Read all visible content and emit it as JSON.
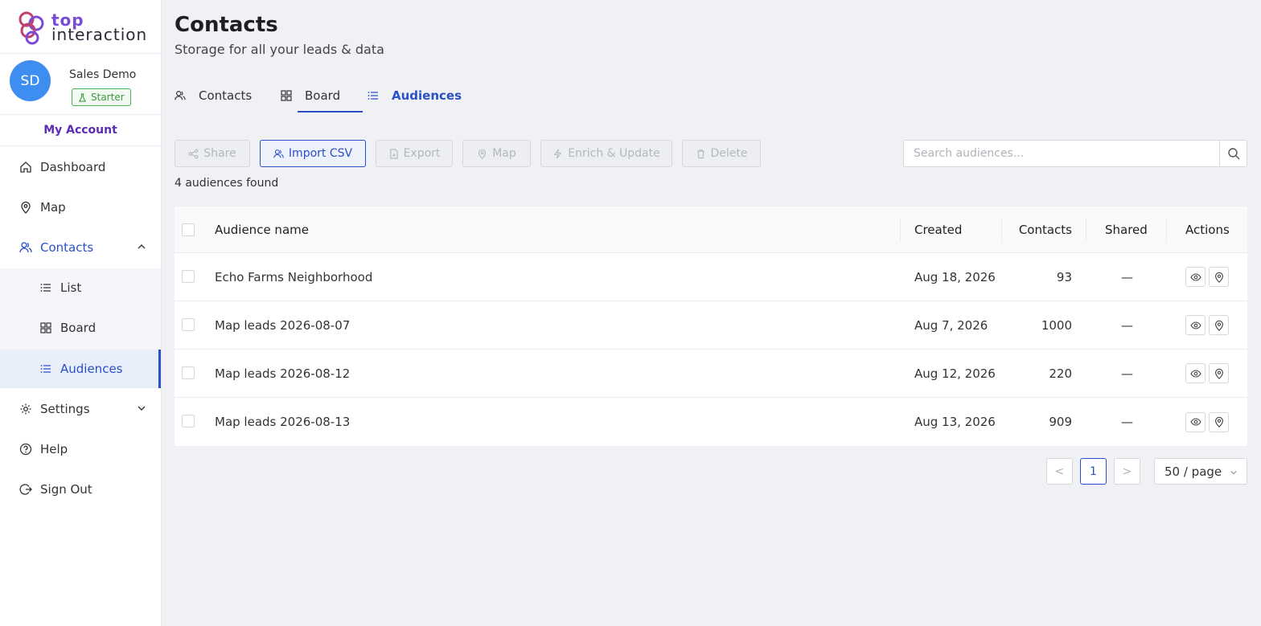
{
  "brand": {
    "line1": "top",
    "line2": "interaction"
  },
  "profile": {
    "initials": "SD",
    "name": "Sales Demo",
    "plan": "Starter"
  },
  "my_account_label": "My Account",
  "nav": {
    "dashboard": "Dashboard",
    "map": "Map",
    "contacts": "Contacts",
    "list": "List",
    "board": "Board",
    "audiences": "Audiences",
    "settings": "Settings",
    "help": "Help",
    "sign_out": "Sign Out"
  },
  "page": {
    "title": "Contacts",
    "subtitle": "Storage for all your leads & data"
  },
  "tabs": {
    "contacts": "Contacts",
    "board": "Board",
    "audiences": "Audiences"
  },
  "toolbar": {
    "share": "Share",
    "import_csv": "Import CSV",
    "export": "Export",
    "map": "Map",
    "enrich": "Enrich & Update",
    "delete": "Delete"
  },
  "search": {
    "placeholder": "Search audiences..."
  },
  "found_count": "4 audiences found",
  "table": {
    "columns": {
      "name": "Audience name",
      "created": "Created",
      "contacts": "Contacts",
      "shared": "Shared",
      "actions": "Actions"
    },
    "rows": [
      {
        "name": "Echo Farms Neighborhood",
        "created": "Aug 18, 2026",
        "contacts": "93",
        "shared": "—"
      },
      {
        "name": "Map leads 2026-08-07",
        "created": "Aug 7, 2026",
        "contacts": "1000",
        "shared": "—"
      },
      {
        "name": "Map leads 2026-08-12",
        "created": "Aug 12, 2026",
        "contacts": "220",
        "shared": "—"
      },
      {
        "name": "Map leads 2026-08-13",
        "created": "Aug 13, 2026",
        "contacts": "909",
        "shared": "—"
      }
    ]
  },
  "pagination": {
    "prev": "<",
    "current_page": "1",
    "next": ">",
    "page_size": "50 / page"
  },
  "colors": {
    "accent": "#2a4fc6",
    "brand_purple": "#7a4cd6",
    "avatar": "#3d8ef0",
    "plan_green": "#4caf50"
  }
}
